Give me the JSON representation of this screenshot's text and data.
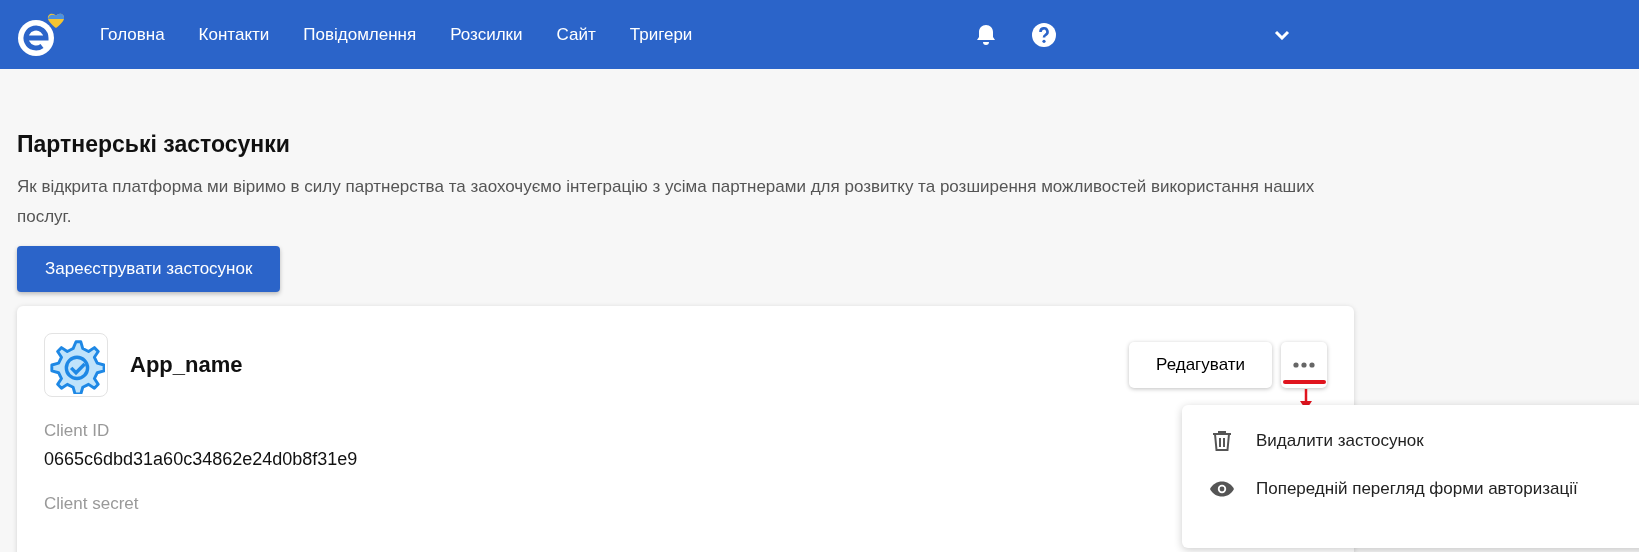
{
  "nav": {
    "items": [
      {
        "label": "Головна"
      },
      {
        "label": "Контакти"
      },
      {
        "label": "Повідомлення"
      },
      {
        "label": "Розсилки"
      },
      {
        "label": "Сайт"
      },
      {
        "label": "Тригери"
      }
    ]
  },
  "page": {
    "title": "Партнерські застосунки",
    "description": "Як відкрита платформа ми віримо в силу партнерства та заохочуємо інтеграцію з усіма партнерами для розвитку та розширення можливостей використання наших послуг.",
    "register_button": "Зареєструвати застосунок"
  },
  "app_card": {
    "name": "App_name",
    "edit_button": "Редагувати",
    "fields": [
      {
        "label": "Client ID",
        "value": "0665c6dbd31a60c34862e24d0b8f31e9"
      },
      {
        "label": "Client secret"
      }
    ]
  },
  "menu": {
    "items": [
      {
        "kind": "delete",
        "label": "Видалити застосунок"
      },
      {
        "kind": "preview",
        "label": "Попередній перегляд форми авторизації"
      }
    ]
  }
}
